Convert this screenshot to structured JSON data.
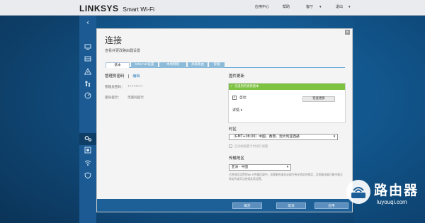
{
  "topbar": {
    "brand": "LINKSYS",
    "product": "Smart Wi-Fi",
    "links": [
      {
        "label": "应用中心",
        "caret": false
      },
      {
        "label": "帮助",
        "caret": false
      },
      {
        "label": "客厅",
        "caret": true
      },
      {
        "label": "退出",
        "caret": true
      }
    ]
  },
  "sidebar": {
    "back_icon": "chevron-left-icon",
    "items": [
      {
        "icon": "devices-icon"
      },
      {
        "icon": "media-prioritization-icon"
      },
      {
        "icon": "alert-icon"
      },
      {
        "icon": "parental-controls-icon"
      },
      {
        "icon": "speed-test-icon"
      },
      {
        "icon": "connectivity-icon",
        "selected": true
      },
      {
        "icon": "troubleshooting-icon"
      },
      {
        "icon": "wireless-icon"
      },
      {
        "icon": "security-icon"
      }
    ]
  },
  "modal": {
    "title": "连接",
    "subtitle": "查看并更改路由器设置",
    "close_glyph": "×",
    "tabs": [
      {
        "label": "基本",
        "active": true
      },
      {
        "label": "Internet设置",
        "active": false
      },
      {
        "label": "本地网络",
        "active": false
      },
      {
        "label": "高级路由",
        "active": false
      },
      {
        "label": "管理",
        "active": false
      }
    ],
    "admin": {
      "heading": "管理员密码",
      "separator": "|",
      "edit_label": "编辑",
      "password_label": "管理员密码：",
      "password_value": "••••••••",
      "hint_label": "密码提示：",
      "hint_value": "无密码提示"
    },
    "firmware": {
      "heading": "固件更新",
      "status": "无适用的更新版本",
      "auto_label": "自动",
      "auto_checked": true,
      "check_button": "检查更新",
      "details_label": "详情"
    },
    "timezone": {
      "heading": "时区",
      "selected": "（GMT+08:00）中国、香港、澳大利亚西部",
      "dst_label": "自动根据夏令时进行调整",
      "dst_checked": false
    },
    "region": {
      "heading": "传输地区",
      "selected": "亚洲 - 中国",
      "note": "已将地区设置到Wi-Fi传输区域中。如需更改请务必遵守所在地区的规定，否则路由器可能不能正常运作或无法使用此类设置。"
    },
    "footer": {
      "ok_label": "确定",
      "cancel_label": "取消",
      "apply_label": "应用"
    }
  },
  "watermark": {
    "text": "路由器",
    "url": "luyouqi.com"
  },
  "colors": {
    "accent_green": "#7ec241",
    "footer_blue": "#1d5f97",
    "sidebar_blue": "#1b5a92",
    "tab_blue": "#8bbbd9"
  }
}
